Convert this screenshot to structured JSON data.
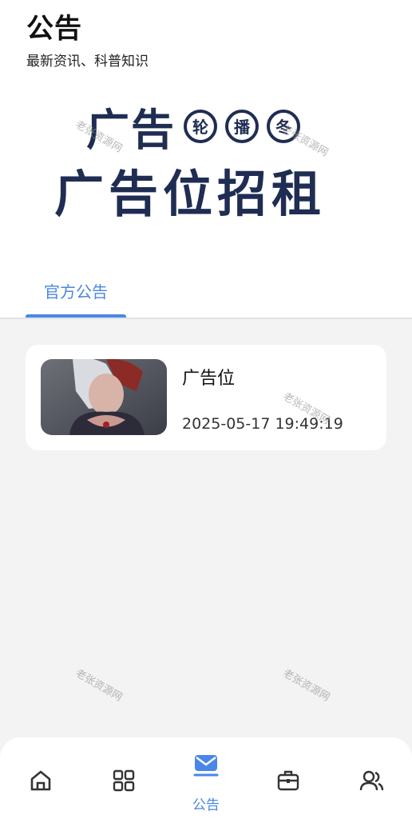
{
  "header": {
    "title": "公告",
    "subtitle": "最新资讯、科普知识"
  },
  "banner": {
    "line1": "广告",
    "circles": [
      "轮",
      "播",
      "冬"
    ],
    "line2": "广告位招租"
  },
  "tabs": [
    {
      "label": "官方公告",
      "active": true
    }
  ],
  "announcements": [
    {
      "title": "广告位",
      "time": "2025-05-17 19:49:19"
    }
  ],
  "watermark": "老张资源网",
  "bottom_nav": [
    {
      "icon": "home-icon",
      "label": "",
      "active": false
    },
    {
      "icon": "grid-icon",
      "label": "",
      "active": false
    },
    {
      "icon": "mail-icon",
      "label": "公告",
      "active": true
    },
    {
      "icon": "briefcase-icon",
      "label": "",
      "active": false
    },
    {
      "icon": "users-icon",
      "label": "",
      "active": false
    }
  ],
  "colors": {
    "accent": "#4a86e8",
    "banner_text": "#1f2d52",
    "background": "#f3f3f3"
  }
}
